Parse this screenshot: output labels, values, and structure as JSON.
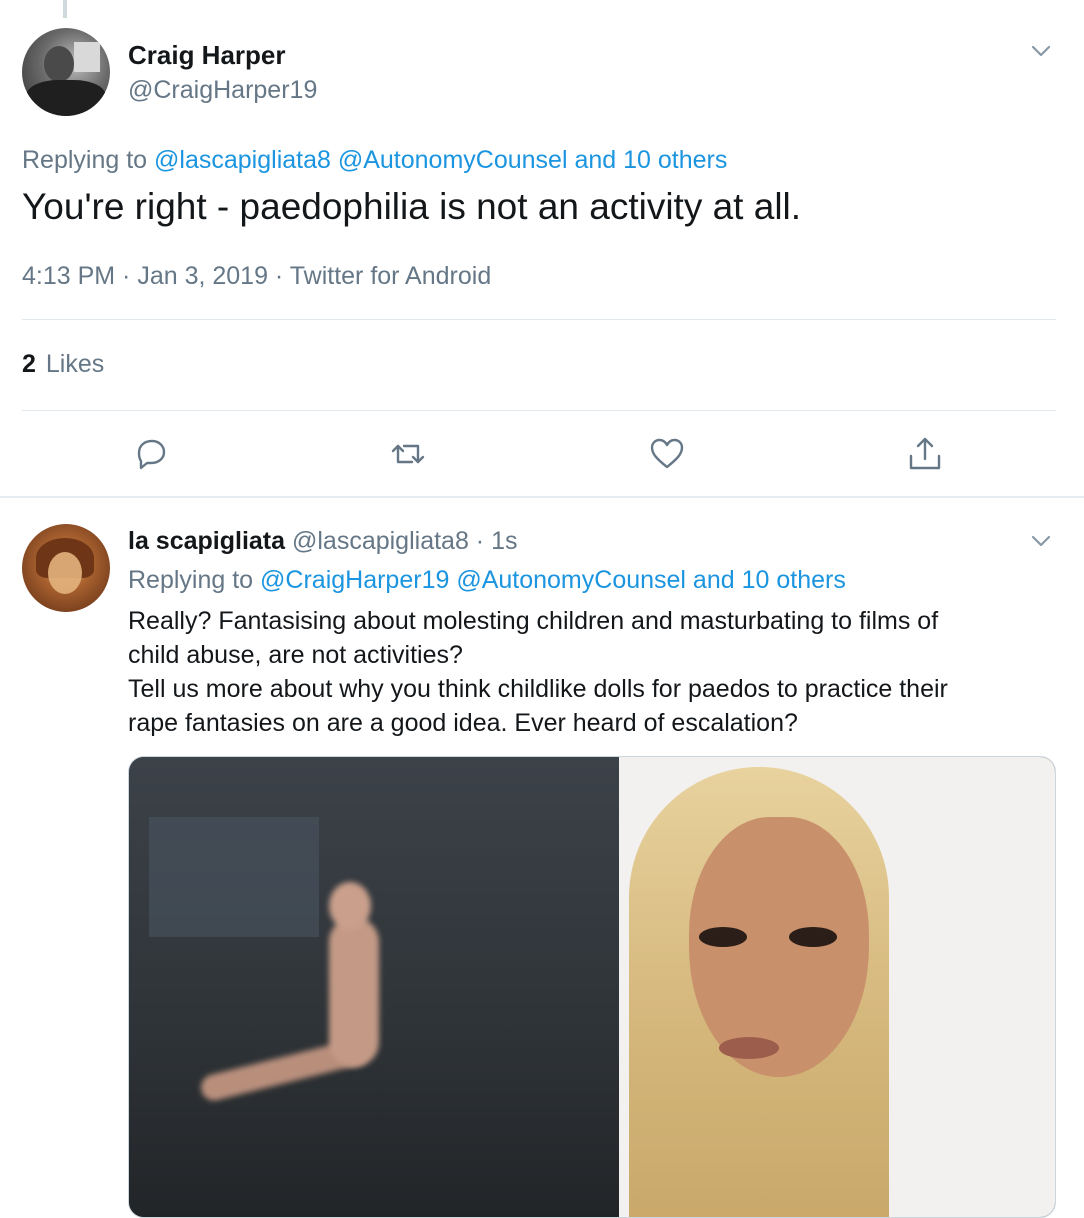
{
  "tweet": {
    "author_name": "Craig Harper",
    "author_handle": "@CraigHarper19",
    "replying_prefix": "Replying to",
    "replying_mentions": "@lascapigliata8 @AutonomyCounsel and 10 others",
    "text": "You're right - paedophilia is not an activity at all.",
    "meta": "4:13 PM · Jan 3, 2019 · Twitter for Android",
    "likes_count": "2",
    "likes_label": "Likes",
    "actions": [
      "reply-icon",
      "retweet-icon",
      "like-icon",
      "share-icon"
    ]
  },
  "reply": {
    "author_name": "la scapigliata",
    "author_handle": "@lascapigliata8 · 1s",
    "replying_prefix": "Replying to",
    "replying_mentions": "@CraigHarper19 @AutonomyCounsel and 10 others",
    "lines": [
      "Really? Fantasising about molesting children and masturbating to films of",
      "child abuse, are not activities?",
      "Tell us more about why you think childlike dolls for paedos to practice their",
      "rape fantasies on are a good idea. Ever heard of escalation?"
    ]
  },
  "colors": {
    "link": "#1b95e0",
    "secondary_text": "#657786",
    "primary_text": "#14171a",
    "divider": "#e1e8ed"
  }
}
